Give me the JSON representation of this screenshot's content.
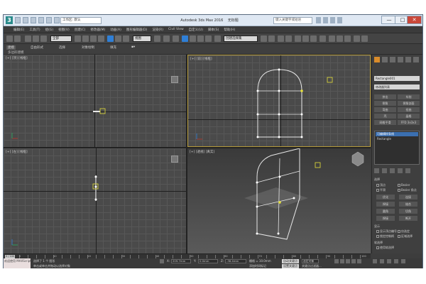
{
  "window": {
    "app_title": "Autodesk 3ds Max 2016",
    "doc_title": "无标题",
    "workspace": "工作区: 默认",
    "search_placeholder": "键入关键字或短语",
    "min": "—",
    "max": "□",
    "close": "✕"
  },
  "menubar": [
    "编辑(E)",
    "工具(T)",
    "组(G)",
    "视图(V)",
    "创建(C)",
    "修改器(M)",
    "动画(A)",
    "图形编辑器(D)",
    "渲染(R)",
    "Civil View",
    "自定义(U)",
    "脚本(S)",
    "帮助(H)"
  ],
  "toolbar": {
    "selection_filter": "全部",
    "view_dropdown": "视图",
    "named_selection": "创建选择集"
  },
  "ribbon": {
    "tabs": [
      "建模",
      "自由形式",
      "选择",
      "对象绘制",
      "填充"
    ],
    "subtitle": "多边形建模"
  },
  "viewports": {
    "top": "[+] [顶] [线框]",
    "front": "[+] [前] [线框]",
    "left": "[+] [左] [线框]",
    "perspective": "[+] [透视] [真实]"
  },
  "command_panel": {
    "object_name": "Rectangle001",
    "modifier_list": "修改器列表",
    "buttons": [
      "挤出",
      "车削",
      "倒角",
      "倒角剖面",
      "弯曲",
      "扭曲",
      "壳",
      "晶格",
      "网格平滑",
      "FFD 3x3x3"
    ],
    "stack": [
      "可编辑样条线",
      "Rectangle"
    ],
    "section_selection": "选择",
    "opt_vertex": "顶点",
    "opt_bezier": "Bezier",
    "opt_smooth": "平滑",
    "opt_corner": "Bezier 角点",
    "btn_refine": "优化",
    "btn_connect": "连接",
    "btn_weld": "焊接",
    "btn_fuse": "熔合",
    "btn_fillet": "圆角",
    "btn_chamfer": "切角",
    "btn_weld2": "焊接",
    "btn_break": "断开",
    "section_display": "显示",
    "opt_show_vertex_num": "显示顶点编号",
    "opt_selected_only": "仅选定",
    "opt_lock_handles": "锁定控制柄",
    "opt_area_select": "区域选择",
    "section_softsel": "软选择",
    "opt_soft": "使用软选择"
  },
  "timeline": {
    "position": "0 / 100",
    "ticks": [
      "0",
      "10",
      "20",
      "30",
      "40",
      "50",
      "60",
      "70",
      "80",
      "90",
      "100"
    ]
  },
  "statusbar": {
    "maxscript": "欢迎使用 MAXScript。",
    "selected": "选择了 1 个 图形",
    "prompt": "单击或单击并拖动以选择对象",
    "x_label": "X:",
    "x_val": "209.7mm",
    "y_label": "Y:",
    "y_val": "0.0mm",
    "z_label": "Z:",
    "z_val": "-38.4mm",
    "grid": "栅格 = 10.0mm",
    "autokey": "自动关键点",
    "setkey": "设置关键点",
    "selected_set": "选定对象",
    "keyfilter": "关键点过滤器...",
    "add_time_tag": "添加时间标记"
  },
  "colors": {
    "accent_orange": "#d98c2b",
    "accent_blue": "#2f7fd6",
    "active_viewport_border": "#b59a3b",
    "shape_line": "#e8e8e8",
    "vertex_yellow": "#e7e23a"
  }
}
